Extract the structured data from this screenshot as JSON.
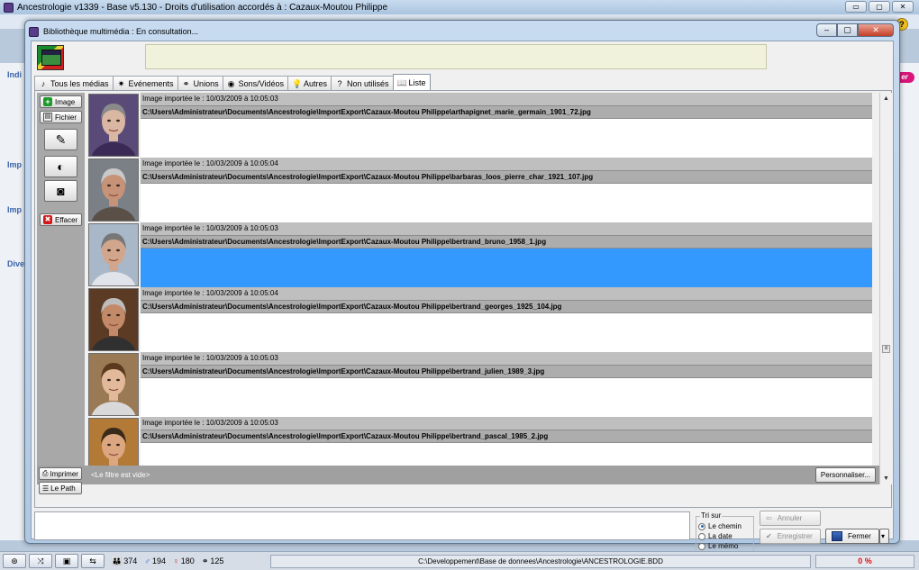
{
  "app": {
    "title": "Ancestrologie v1339 - Base v5.130 - Droits d'utilisation accordés à : Cazaux-Moutou Philippe",
    "winbtn_min": "▭",
    "winbtn_max": "▢",
    "winbtn_close": "✕",
    "help": "?",
    "pill": "er",
    "left_labels": [
      "Indi",
      "Imp",
      "Imp",
      "Dive"
    ]
  },
  "dialog": {
    "title": "Bibliothèque multimédia : En consultation...",
    "btn_min": "–",
    "btn_max": "▢",
    "btn_close": "✕"
  },
  "tabs": [
    {
      "label": "Tous les médias",
      "icon": "music-icon",
      "glyph": "♪"
    },
    {
      "label": "Evénements",
      "icon": "events-icon",
      "glyph": "✷"
    },
    {
      "label": "Unions",
      "icon": "unions-icon",
      "glyph": "⚭"
    },
    {
      "label": "Sons/Vidéos",
      "icon": "sounds-videos-icon",
      "glyph": "◉"
    },
    {
      "label": "Autres",
      "icon": "bulb-icon",
      "glyph": "💡"
    },
    {
      "label": "Non utilisés",
      "icon": "help-icon",
      "glyph": "?"
    },
    {
      "label": "Liste",
      "icon": "book-icon",
      "glyph": "📖"
    }
  ],
  "toolbar": {
    "image_label": "Image",
    "fichier_label": "Fichier",
    "scanner_glyph": "✎",
    "webcam_glyph": "◐",
    "camera_glyph": "◙",
    "effacer_label": "Effacer",
    "imprimer_label": "Imprimer",
    "lepath_label": "Le Path",
    "plus_glyph": "+",
    "file_glyph": "▤",
    "del_glyph": "✖",
    "print_glyph": "⎙",
    "path_glyph": "☰"
  },
  "records": [
    {
      "imported": "Image importée le : 10/03/2009 à 10:05:03",
      "path": "C:\\Users\\Administrateur\\Documents\\Ancestrologie\\ImportExport\\Cazaux-Moutou Philippe\\arthapignet_marie_germain_1901_72.jpg",
      "selected": false
    },
    {
      "imported": "Image importée le : 10/03/2009 à 10:05:04",
      "path": "C:\\Users\\Administrateur\\Documents\\Ancestrologie\\ImportExport\\Cazaux-Moutou Philippe\\barbaras_loos_pierre_char_1921_107.jpg",
      "selected": false
    },
    {
      "imported": "Image importée le : 10/03/2009 à 10:05:03",
      "path": "C:\\Users\\Administrateur\\Documents\\Ancestrologie\\ImportExport\\Cazaux-Moutou Philippe\\bertrand_bruno_1958_1.jpg",
      "selected": true
    },
    {
      "imported": "Image importée le : 10/03/2009 à 10:05:04",
      "path": "C:\\Users\\Administrateur\\Documents\\Ancestrologie\\ImportExport\\Cazaux-Moutou Philippe\\bertrand_georges_1925_104.jpg",
      "selected": false
    },
    {
      "imported": "Image importée le : 10/03/2009 à 10:05:03",
      "path": "C:\\Users\\Administrateur\\Documents\\Ancestrologie\\ImportExport\\Cazaux-Moutou Philippe\\bertrand_julien_1989_3.jpg",
      "selected": false
    },
    {
      "imported": "Image importée le : 10/03/2009 à 10:05:03",
      "path": "C:\\Users\\Administrateur\\Documents\\Ancestrologie\\ImportExport\\Cazaux-Moutou Philippe\\bertrand_pascal_1985_2.jpg",
      "selected": false
    }
  ],
  "filter": {
    "text": "<Le filtre est vide>",
    "personnaliser_label": "Personnaliser..."
  },
  "scroll": {
    "up": "▲",
    "down": "▼",
    "grip": "≡"
  },
  "sort": {
    "legend": "Tri sur",
    "options": [
      "Le chemin",
      "La date",
      "Le mémo"
    ],
    "selected": "Le chemin"
  },
  "actions": {
    "annuler_label": "Annuler",
    "enregistrer_label": "Enregistrer",
    "fermer_label": "Fermer",
    "annuler_glyph": "⇦",
    "enregistrer_glyph": "✔",
    "dropdown_glyph": "▾"
  },
  "status": {
    "btn1": "⊛",
    "btn2": "⤨",
    "btn3": "▣",
    "btn4": "⇆",
    "count_individus": "374",
    "count_hommes": "194",
    "count_femmes": "180",
    "count_unions": "125",
    "sym_individus": "👪",
    "sym_hommes": "♂",
    "sym_femmes": "♀",
    "sym_unions": "⚭",
    "db_path": "C:\\Developpement\\Base de donnees\\Ancestrologie\\ANCESTROLOGIE.BDD",
    "percent": "0 %"
  },
  "colors": {
    "selection": "#3399ff",
    "row_header": "#bfbfbf",
    "path_row": "#adadad",
    "men": "#1b5fd6",
    "women": "#d41f1f"
  }
}
